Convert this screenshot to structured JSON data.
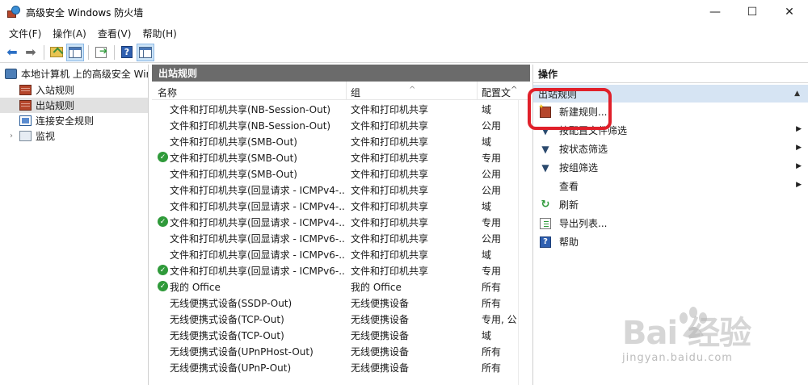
{
  "window": {
    "title": "高级安全 Windows 防火墙",
    "minimize": "—",
    "maximize": "☐",
    "close": "✕"
  },
  "menu": [
    "文件(F)",
    "操作(A)",
    "查看(V)",
    "帮助(H)"
  ],
  "tree": {
    "root": "本地计算机 上的高级安全 Windows",
    "items": [
      {
        "label": "入站规则",
        "icon": "firewall-icon"
      },
      {
        "label": "出站规则",
        "icon": "firewall-icon",
        "selected": true
      },
      {
        "label": "连接安全规则",
        "icon": "connection-icon"
      },
      {
        "label": "监视",
        "icon": "monitor-icon"
      }
    ]
  },
  "center": {
    "title": "出站规则",
    "columns": {
      "name": "名称",
      "group": "组",
      "profile": "配置文件"
    },
    "rows": [
      {
        "name": "文件和打印机共享(NB-Session-Out)",
        "group": "文件和打印机共享",
        "profile": "域",
        "enabled": false
      },
      {
        "name": "文件和打印机共享(NB-Session-Out)",
        "group": "文件和打印机共享",
        "profile": "公用",
        "enabled": false
      },
      {
        "name": "文件和打印机共享(SMB-Out)",
        "group": "文件和打印机共享",
        "profile": "域",
        "enabled": false
      },
      {
        "name": "文件和打印机共享(SMB-Out)",
        "group": "文件和打印机共享",
        "profile": "专用",
        "enabled": true
      },
      {
        "name": "文件和打印机共享(SMB-Out)",
        "group": "文件和打印机共享",
        "profile": "公用",
        "enabled": false
      },
      {
        "name": "文件和打印机共享(回显请求 - ICMPv4-...",
        "group": "文件和打印机共享",
        "profile": "公用",
        "enabled": false
      },
      {
        "name": "文件和打印机共享(回显请求 - ICMPv4-...",
        "group": "文件和打印机共享",
        "profile": "域",
        "enabled": false
      },
      {
        "name": "文件和打印机共享(回显请求 - ICMPv4-...",
        "group": "文件和打印机共享",
        "profile": "专用",
        "enabled": true
      },
      {
        "name": "文件和打印机共享(回显请求 - ICMPv6-...",
        "group": "文件和打印机共享",
        "profile": "公用",
        "enabled": false
      },
      {
        "name": "文件和打印机共享(回显请求 - ICMPv6-...",
        "group": "文件和打印机共享",
        "profile": "域",
        "enabled": false
      },
      {
        "name": "文件和打印机共享(回显请求 - ICMPv6-...",
        "group": "文件和打印机共享",
        "profile": "专用",
        "enabled": true
      },
      {
        "name": "我的 Office",
        "group": "我的 Office",
        "profile": "所有",
        "enabled": true
      },
      {
        "name": "无线便携式设备(SSDP-Out)",
        "group": "无线便携设备",
        "profile": "所有",
        "enabled": false
      },
      {
        "name": "无线便携式设备(TCP-Out)",
        "group": "无线便携设备",
        "profile": "专用, 公",
        "enabled": false
      },
      {
        "name": "无线便携式设备(TCP-Out)",
        "group": "无线便携设备",
        "profile": "域",
        "enabled": false
      },
      {
        "name": "无线便携式设备(UPnPHost-Out)",
        "group": "无线便携设备",
        "profile": "所有",
        "enabled": false
      },
      {
        "name": "无线便携式设备(UPnP-Out)",
        "group": "无线便携设备",
        "profile": "所有",
        "enabled": false
      }
    ]
  },
  "actions": {
    "title": "操作",
    "section": "出站规则",
    "items": [
      {
        "label": "新建规则...",
        "icon": "new-rule-icon",
        "submenu": false
      },
      {
        "label": "按配置文件筛选",
        "icon": "filter-icon",
        "submenu": true
      },
      {
        "label": "按状态筛选",
        "icon": "filter-icon",
        "submenu": true
      },
      {
        "label": "按组筛选",
        "icon": "filter-icon",
        "submenu": true
      },
      {
        "label": "查看",
        "icon": "",
        "submenu": true
      },
      {
        "label": "刷新",
        "icon": "refresh-icon",
        "submenu": false
      },
      {
        "label": "导出列表...",
        "icon": "export-list-icon",
        "submenu": false
      },
      {
        "label": "帮助",
        "icon": "help-icon",
        "submenu": false
      }
    ]
  },
  "watermark": {
    "main": "Bai  经验",
    "sub": "jingyan.baidu.com"
  },
  "colors": {
    "highlight": "#e0202a",
    "section_bg": "#d6e4f3",
    "header_bg": "#6b6b6b",
    "check": "#2f9a3a"
  }
}
